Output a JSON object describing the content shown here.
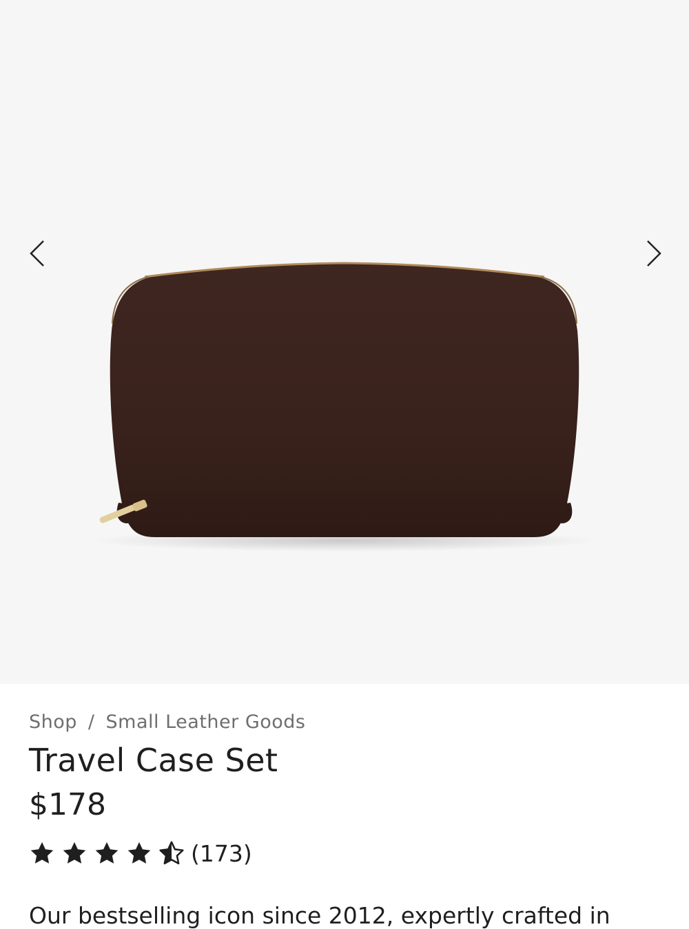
{
  "gallery": {
    "image_alt": "Travel Case Set in dark brown pebbled leather",
    "prev_icon": "chevron-left-icon",
    "next_icon": "chevron-right-icon",
    "product_color": "#3a221c",
    "background_color": "#f6f6f6"
  },
  "breadcrumb": {
    "items": [
      "Shop",
      "Small Leather Goods"
    ],
    "separator": "/"
  },
  "product": {
    "title": "Travel Case Set",
    "price": "$178",
    "rating": 4.5,
    "rating_max": 5,
    "review_count": "(173)",
    "description": "Our bestselling icon since 2012, expertly crafted in"
  }
}
